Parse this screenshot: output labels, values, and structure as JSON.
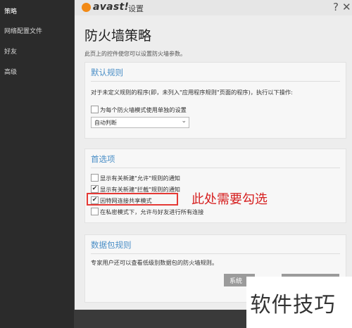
{
  "sidebar": {
    "items": [
      {
        "label": "策略",
        "active": true
      },
      {
        "label": "网络配置文件",
        "active": false
      },
      {
        "label": "好友",
        "active": false
      },
      {
        "label": "高级",
        "active": false
      }
    ]
  },
  "window": {
    "logo_text": "avast!",
    "title": "设置",
    "help_symbol": "?",
    "close_symbol": "✕"
  },
  "page": {
    "title": "防火墙策略",
    "description": "此页上的控件使您可以设置防火墙参数。"
  },
  "default_rules": {
    "title": "默认规则",
    "text": "对于未定义规则的程序(即，未列入\"应用程序规则\"页面的程序)，执行以下操作:",
    "checkbox_label": "为每个防火墙模式使用单独的设置",
    "checkbox_checked": false,
    "dropdown_value": "自动判断"
  },
  "preferences": {
    "title": "首选项",
    "options": [
      {
        "label": "显示有关新建\"允许\"规则的通知",
        "checked": false
      },
      {
        "label": "显示有关新建\"拦截\"规则的通知",
        "checked": true
      },
      {
        "label": "因特网连接共享模式",
        "checked": true
      },
      {
        "label": "在私密模式下，允许与好友进行所有连接",
        "checked": false
      }
    ]
  },
  "packet_rules": {
    "title": "数据包规则",
    "text": "专家用户还可以查看低级别数据包的防火墙规则。",
    "system_button_label": "系统"
  },
  "annotation": {
    "text": "此处需要勾选"
  },
  "watermark": {
    "text": "软件技巧"
  },
  "colors": {
    "accent_blue": "#4b8fc7",
    "annotation_red": "#d61f1f",
    "logo_orange": "#f28a16"
  }
}
